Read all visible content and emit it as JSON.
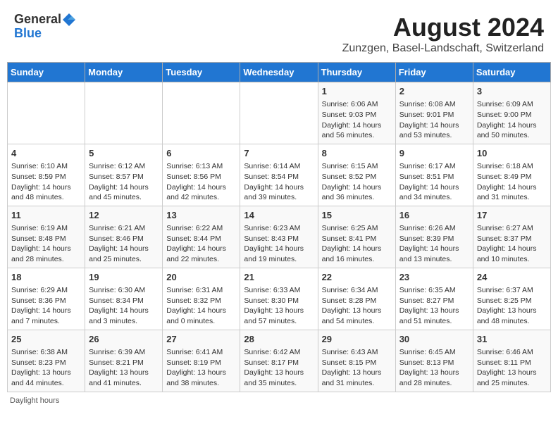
{
  "header": {
    "logo_general": "General",
    "logo_blue": "Blue",
    "title": "August 2024",
    "subtitle": "Zunzgen, Basel-Landschaft, Switzerland"
  },
  "calendar": {
    "days_of_week": [
      "Sunday",
      "Monday",
      "Tuesday",
      "Wednesday",
      "Thursday",
      "Friday",
      "Saturday"
    ],
    "weeks": [
      [
        {
          "day": "",
          "info": ""
        },
        {
          "day": "",
          "info": ""
        },
        {
          "day": "",
          "info": ""
        },
        {
          "day": "",
          "info": ""
        },
        {
          "day": "1",
          "info": "Sunrise: 6:06 AM\nSunset: 9:03 PM\nDaylight: 14 hours and 56 minutes."
        },
        {
          "day": "2",
          "info": "Sunrise: 6:08 AM\nSunset: 9:01 PM\nDaylight: 14 hours and 53 minutes."
        },
        {
          "day": "3",
          "info": "Sunrise: 6:09 AM\nSunset: 9:00 PM\nDaylight: 14 hours and 50 minutes."
        }
      ],
      [
        {
          "day": "4",
          "info": "Sunrise: 6:10 AM\nSunset: 8:59 PM\nDaylight: 14 hours and 48 minutes."
        },
        {
          "day": "5",
          "info": "Sunrise: 6:12 AM\nSunset: 8:57 PM\nDaylight: 14 hours and 45 minutes."
        },
        {
          "day": "6",
          "info": "Sunrise: 6:13 AM\nSunset: 8:56 PM\nDaylight: 14 hours and 42 minutes."
        },
        {
          "day": "7",
          "info": "Sunrise: 6:14 AM\nSunset: 8:54 PM\nDaylight: 14 hours and 39 minutes."
        },
        {
          "day": "8",
          "info": "Sunrise: 6:15 AM\nSunset: 8:52 PM\nDaylight: 14 hours and 36 minutes."
        },
        {
          "day": "9",
          "info": "Sunrise: 6:17 AM\nSunset: 8:51 PM\nDaylight: 14 hours and 34 minutes."
        },
        {
          "day": "10",
          "info": "Sunrise: 6:18 AM\nSunset: 8:49 PM\nDaylight: 14 hours and 31 minutes."
        }
      ],
      [
        {
          "day": "11",
          "info": "Sunrise: 6:19 AM\nSunset: 8:48 PM\nDaylight: 14 hours and 28 minutes."
        },
        {
          "day": "12",
          "info": "Sunrise: 6:21 AM\nSunset: 8:46 PM\nDaylight: 14 hours and 25 minutes."
        },
        {
          "day": "13",
          "info": "Sunrise: 6:22 AM\nSunset: 8:44 PM\nDaylight: 14 hours and 22 minutes."
        },
        {
          "day": "14",
          "info": "Sunrise: 6:23 AM\nSunset: 8:43 PM\nDaylight: 14 hours and 19 minutes."
        },
        {
          "day": "15",
          "info": "Sunrise: 6:25 AM\nSunset: 8:41 PM\nDaylight: 14 hours and 16 minutes."
        },
        {
          "day": "16",
          "info": "Sunrise: 6:26 AM\nSunset: 8:39 PM\nDaylight: 14 hours and 13 minutes."
        },
        {
          "day": "17",
          "info": "Sunrise: 6:27 AM\nSunset: 8:37 PM\nDaylight: 14 hours and 10 minutes."
        }
      ],
      [
        {
          "day": "18",
          "info": "Sunrise: 6:29 AM\nSunset: 8:36 PM\nDaylight: 14 hours and 7 minutes."
        },
        {
          "day": "19",
          "info": "Sunrise: 6:30 AM\nSunset: 8:34 PM\nDaylight: 14 hours and 3 minutes."
        },
        {
          "day": "20",
          "info": "Sunrise: 6:31 AM\nSunset: 8:32 PM\nDaylight: 14 hours and 0 minutes."
        },
        {
          "day": "21",
          "info": "Sunrise: 6:33 AM\nSunset: 8:30 PM\nDaylight: 13 hours and 57 minutes."
        },
        {
          "day": "22",
          "info": "Sunrise: 6:34 AM\nSunset: 8:28 PM\nDaylight: 13 hours and 54 minutes."
        },
        {
          "day": "23",
          "info": "Sunrise: 6:35 AM\nSunset: 8:27 PM\nDaylight: 13 hours and 51 minutes."
        },
        {
          "day": "24",
          "info": "Sunrise: 6:37 AM\nSunset: 8:25 PM\nDaylight: 13 hours and 48 minutes."
        }
      ],
      [
        {
          "day": "25",
          "info": "Sunrise: 6:38 AM\nSunset: 8:23 PM\nDaylight: 13 hours and 44 minutes."
        },
        {
          "day": "26",
          "info": "Sunrise: 6:39 AM\nSunset: 8:21 PM\nDaylight: 13 hours and 41 minutes."
        },
        {
          "day": "27",
          "info": "Sunrise: 6:41 AM\nSunset: 8:19 PM\nDaylight: 13 hours and 38 minutes."
        },
        {
          "day": "28",
          "info": "Sunrise: 6:42 AM\nSunset: 8:17 PM\nDaylight: 13 hours and 35 minutes."
        },
        {
          "day": "29",
          "info": "Sunrise: 6:43 AM\nSunset: 8:15 PM\nDaylight: 13 hours and 31 minutes."
        },
        {
          "day": "30",
          "info": "Sunrise: 6:45 AM\nSunset: 8:13 PM\nDaylight: 13 hours and 28 minutes."
        },
        {
          "day": "31",
          "info": "Sunrise: 6:46 AM\nSunset: 8:11 PM\nDaylight: 13 hours and 25 minutes."
        }
      ]
    ]
  },
  "footer": {
    "label": "Daylight hours"
  }
}
